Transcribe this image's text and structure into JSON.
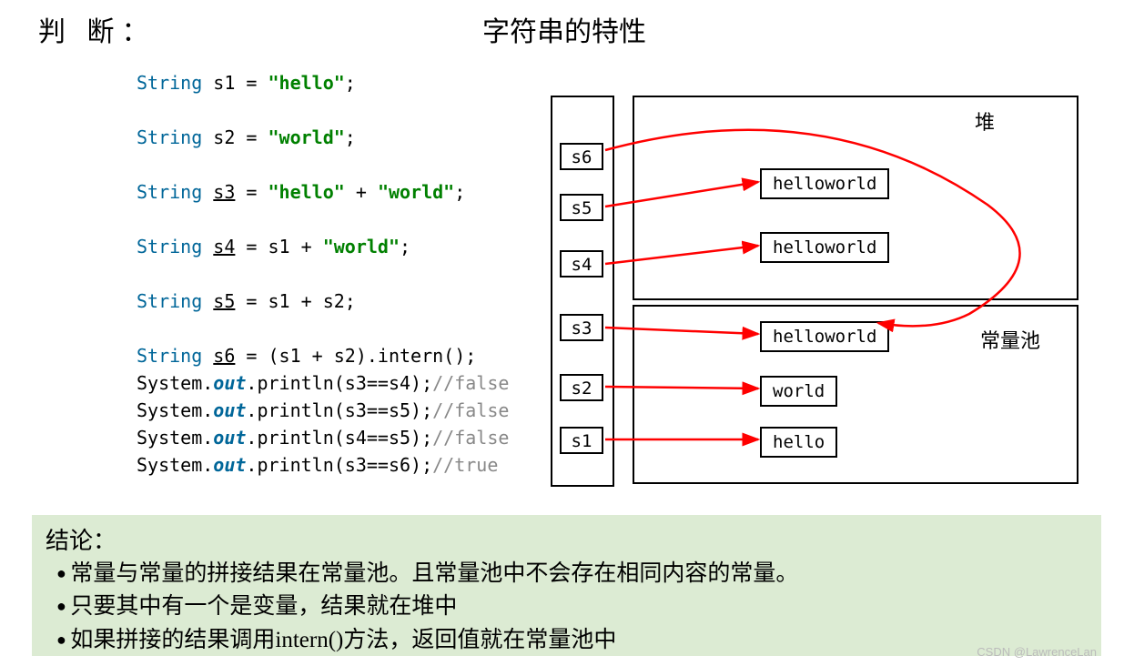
{
  "header": {
    "judge": "判 断：",
    "title": "字符串的特性"
  },
  "code": {
    "l1_a": "String",
    "l1_b": " s1 = ",
    "l1_c": "\"hello\"",
    "l1_d": ";",
    "l2_a": "String",
    "l2_b": " s2 = ",
    "l2_c": "\"world\"",
    "l2_d": ";",
    "l3_a": "String",
    "l3_b": " ",
    "l3_v": "s3",
    "l3_c": " = ",
    "l3_d": "\"hello\"",
    "l3_e": " + ",
    "l3_f": "\"world\"",
    "l3_g": ";",
    "l4_a": "String",
    "l4_b": " ",
    "l4_v": "s4",
    "l4_c": " = s1 + ",
    "l4_d": "\"world\"",
    "l4_e": ";",
    "l5_a": "String",
    "l5_b": " ",
    "l5_v": "s5",
    "l5_c": " = s1 + s2;",
    "l6_a": "String",
    "l6_b": " ",
    "l6_v": "s6",
    "l6_c": " = (s1 + s2).intern();",
    "l7_a": "System.",
    "l7_b": "out",
    "l7_c": ".println(s3==s4);",
    "l7_d": "//false",
    "l8_a": "System.",
    "l8_b": "out",
    "l8_c": ".println(s3==s5);",
    "l8_d": "//false",
    "l9_a": "System.",
    "l9_b": "out",
    "l9_c": ".println(s4==s5);",
    "l9_d": "//false",
    "l10_a": "System.",
    "l10_b": "out",
    "l10_c": ".println(s3==s6);",
    "l10_d": "//true"
  },
  "diagram": {
    "heap_label": "堆",
    "pool_label": "常量池",
    "stack": {
      "s1": "s1",
      "s2": "s2",
      "s3": "s3",
      "s4": "s4",
      "s5": "s5",
      "s6": "s6"
    },
    "heap": {
      "h1": "helloworld",
      "h2": "helloworld"
    },
    "pool": {
      "p1": "helloworld",
      "p2": "world",
      "p3": "hello"
    }
  },
  "conclusion": {
    "title": "结论：",
    "items": [
      "常量与常量的拼接结果在常量池。且常量池中不会存在相同内容的常量。",
      "只要其中有一个是变量，结果就在堆中",
      "如果拼接的结果调用intern()方法，返回值就在常量池中"
    ]
  },
  "watermark": "CSDN @LawrenceLan"
}
